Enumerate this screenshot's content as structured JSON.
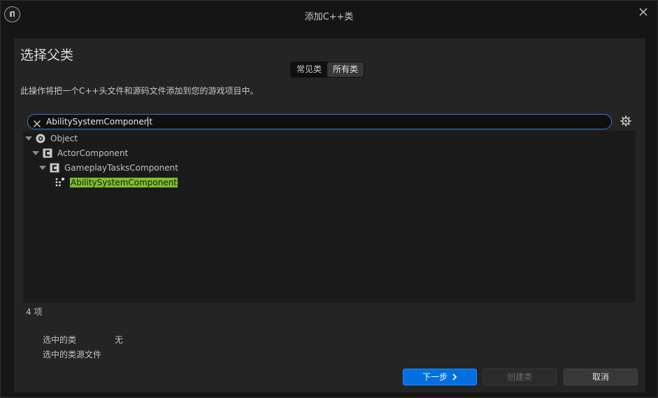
{
  "window": {
    "title": "添加C++类"
  },
  "heading": "选择父类",
  "tabs": [
    {
      "label": "常见类",
      "active": false
    },
    {
      "label": "所有类",
      "active": true
    }
  ],
  "description": "此操作将把一个C++头文件和源码文件添加到您的游戏项目中。",
  "search": {
    "value": "AbilitySystemComponent"
  },
  "tree": [
    {
      "label": "Object",
      "icon": "object-icon",
      "expanded": true
    },
    {
      "label": "ActorComponent",
      "icon": "class-icon",
      "expanded": true
    },
    {
      "label": "GameplayTasksComponent",
      "icon": "class-icon",
      "expanded": true
    },
    {
      "label": "AbilitySystemComponent",
      "icon": "component-icon",
      "expanded": false,
      "highlighted": true
    }
  ],
  "count_label": "4 项",
  "info": {
    "selected_class_label": "选中的类",
    "selected_class_value": "无",
    "selected_source_label": "选中的类源文件"
  },
  "buttons": {
    "next": "下一步",
    "create": "创建类",
    "cancel": "取消"
  },
  "colors": {
    "accent": "#0070e0",
    "highlight": "#7ebf2a",
    "focus_border": "#2f7bd3"
  }
}
